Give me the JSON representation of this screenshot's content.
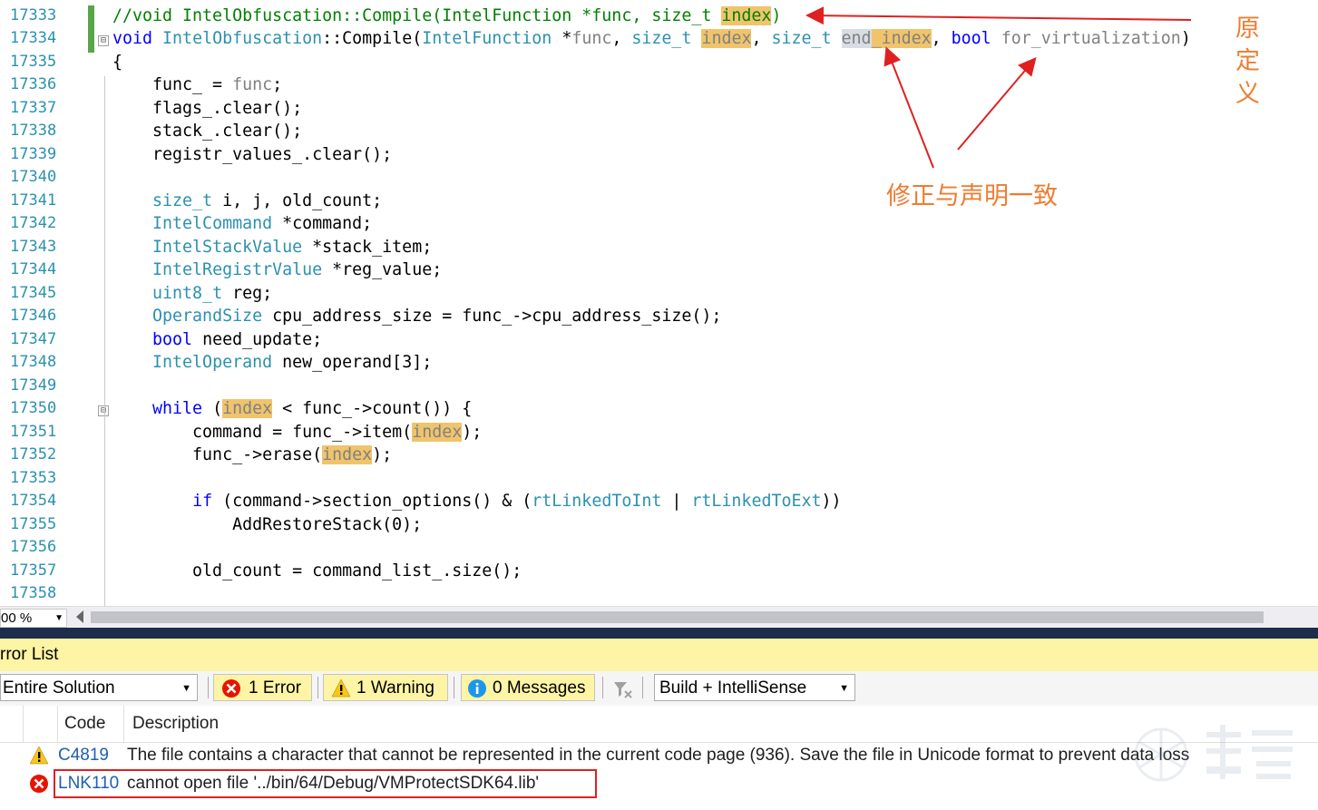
{
  "editor": {
    "line_numbers": [
      "17333",
      "17334",
      "17335",
      "17336",
      "17337",
      "17338",
      "17339",
      "17340",
      "17341",
      "17342",
      "17343",
      "17344",
      "17345",
      "17346",
      "17347",
      "17348",
      "17349",
      "17350",
      "17351",
      "17352",
      "17353",
      "17354",
      "17355",
      "17356",
      "17357",
      "17358"
    ],
    "fold_toggle": "⊟"
  },
  "annotations": {
    "original_definition": "原定义",
    "fixed_to_match": "修正与声明一致"
  },
  "zoom": {
    "value": "00 %"
  },
  "error_list": {
    "title": "rror List",
    "scope": "Entire Solution",
    "errors_label": "1 Error",
    "warnings_label": "1 Warning",
    "messages_label": "0 Messages",
    "build_filter": "Build + IntelliSense",
    "columns": {
      "code": "Code",
      "description": "Description"
    },
    "rows": [
      {
        "severity": "warning",
        "code": "C4819",
        "description": "The file contains a character that cannot be represented in the current code page (936). Save the file in Unicode format to prevent data loss"
      },
      {
        "severity": "error",
        "code": "LNK110",
        "description": "cannot open file '../bin/64/Debug/VMProtectSDK64.lib'"
      }
    ]
  },
  "colors": {
    "accent_annotation": "#ed7d31",
    "arrow": "#e02020",
    "highlight": "#f0c46c"
  }
}
